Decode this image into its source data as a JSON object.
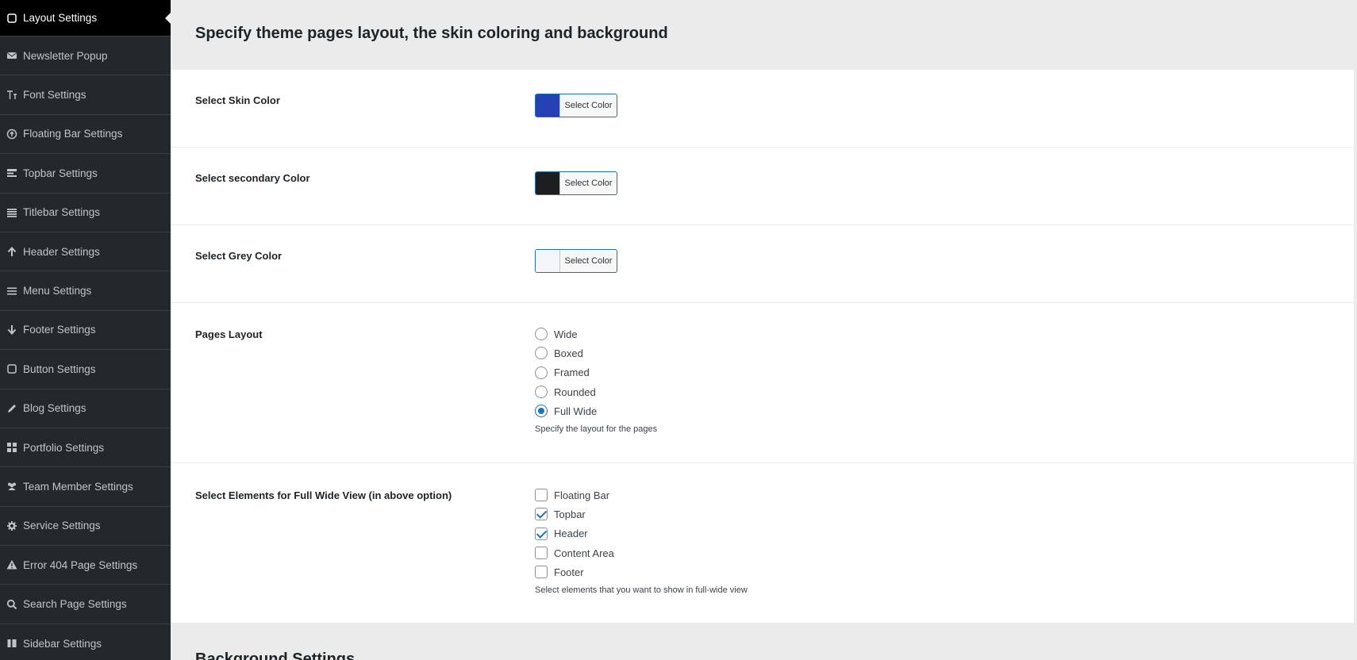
{
  "sidebar": {
    "items": [
      {
        "label": "Layout Settings",
        "icon": "square-icon",
        "active": true
      },
      {
        "label": "Newsletter Popup",
        "icon": "envelope-icon"
      },
      {
        "label": "Font Settings",
        "icon": "text-icon"
      },
      {
        "label": "Floating Bar Settings",
        "icon": "arrow-circle-up-icon"
      },
      {
        "label": "Topbar Settings",
        "icon": "topbar-icon"
      },
      {
        "label": "Titlebar Settings",
        "icon": "list-icon"
      },
      {
        "label": "Header Settings",
        "icon": "arrow-up-icon"
      },
      {
        "label": "Menu Settings",
        "icon": "menu-icon"
      },
      {
        "label": "Footer Settings",
        "icon": "arrow-down-icon"
      },
      {
        "label": "Button Settings",
        "icon": "square-icon"
      },
      {
        "label": "Blog Settings",
        "icon": "pencil-icon"
      },
      {
        "label": "Portfolio Settings",
        "icon": "grid-icon"
      },
      {
        "label": "Team Member Settings",
        "icon": "users-icon"
      },
      {
        "label": "Service Settings",
        "icon": "gear-icon"
      },
      {
        "label": "Error 404 Page Settings",
        "icon": "warning-icon"
      },
      {
        "label": "Search Page Settings",
        "icon": "search-icon"
      },
      {
        "label": "Sidebar Settings",
        "icon": "columns-icon"
      }
    ]
  },
  "main": {
    "title": "Specify theme pages layout, the skin coloring and background",
    "skin_color": {
      "label": "Select Skin Color",
      "button": "Select Color",
      "value": "#2440b3"
    },
    "secondary_color": {
      "label": "Select secondary Color",
      "button": "Select Color",
      "value": "#1d1e20"
    },
    "grey_color": {
      "label": "Select Grey Color",
      "button": "Select Color",
      "value": "#f5f6f9"
    },
    "pages_layout": {
      "label": "Pages Layout",
      "options": [
        "Wide",
        "Boxed",
        "Framed",
        "Rounded",
        "Full Wide"
      ],
      "selected": "Full Wide",
      "hint": "Specify the layout for the pages"
    },
    "full_wide_elements": {
      "label": "Select Elements for Full Wide View (in above option)",
      "options": [
        {
          "label": "Floating Bar",
          "checked": false
        },
        {
          "label": "Topbar",
          "checked": true
        },
        {
          "label": "Header",
          "checked": true
        },
        {
          "label": "Content Area",
          "checked": false
        },
        {
          "label": "Footer",
          "checked": false
        }
      ],
      "hint": "Select elements that you want to show in full-wide view"
    },
    "background_title": "Background Settings"
  },
  "colors": {
    "accent": "#2271b1",
    "sidebar_bg": "#23282d",
    "sidebar_active": "#000000"
  }
}
